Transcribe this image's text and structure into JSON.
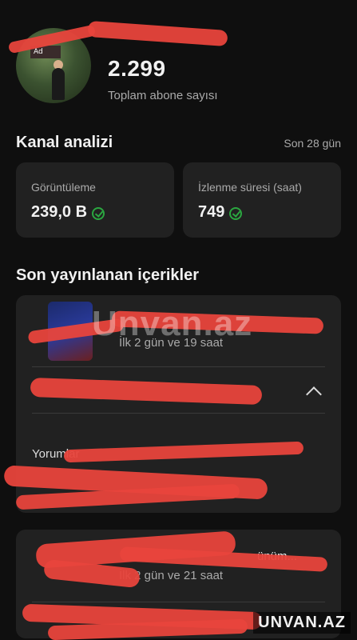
{
  "channel": {
    "subscriber_count": "2.299",
    "subscriber_label": "Toplam abone sayısı",
    "avatar_sign_text": "Ad"
  },
  "analytics": {
    "title": "Kanal analizi",
    "period": "Son 28 gün",
    "metrics": [
      {
        "label": "Görüntüleme",
        "value": "239,0 B",
        "status_icon": "check-circle-icon"
      },
      {
        "label": "İzlenme süresi (saat)",
        "value": "749",
        "status_icon": "check-circle-icon"
      }
    ]
  },
  "recent": {
    "title": "Son yayınlanan içerikler",
    "items": [
      {
        "meta": "İlk 2 gün ve 19 saat",
        "comments_label": "Yorumlar"
      },
      {
        "meta": "İlk 2 gün ve 21 saat",
        "title_tail": "ünüm..."
      }
    ]
  },
  "watermark": {
    "center": "Unvan.az",
    "corner": "UNVAN.AZ"
  },
  "colors": {
    "background": "#0f0f0f",
    "card": "#212121",
    "accent_green": "#2ba640",
    "redaction": "#e8453c"
  }
}
